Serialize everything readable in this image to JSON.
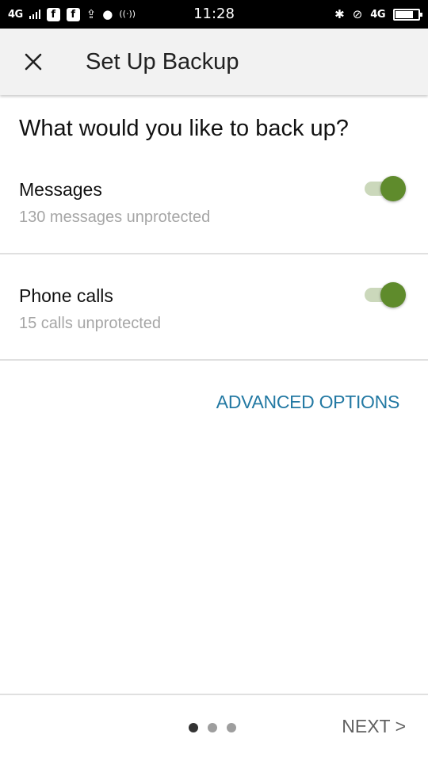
{
  "status_bar": {
    "network": "4G",
    "network_right": "4G",
    "time": "11:28",
    "icons": [
      "signal-icon",
      "facebook-icon",
      "facebook-icon",
      "upload-icon",
      "chat-icon",
      "hotspot-icon",
      "bluetooth-icon",
      "mute-icon",
      "battery-icon"
    ],
    "fb_glyph": "f",
    "upload_glyph": "⇪",
    "chat_glyph": "●",
    "hotspot_glyph": "((·))",
    "bluetooth_glyph": "✱",
    "mute_glyph": "⊘"
  },
  "app_bar": {
    "title": "Set Up Backup",
    "close_icon": "close-icon"
  },
  "content": {
    "question": "What would you like to back up?",
    "options": [
      {
        "label": "Messages",
        "subtitle": "130 messages unprotected",
        "enabled": true
      },
      {
        "label": "Phone calls",
        "subtitle": "15 calls unprotected",
        "enabled": true
      }
    ],
    "advanced_label": "ADVANCED OPTIONS"
  },
  "footer": {
    "page_index": 1,
    "page_count": 3,
    "next_label": "NEXT >"
  },
  "colors": {
    "accent": "#2379a3",
    "toggle_on": "#5f8b2c",
    "toggle_track": "#cbd8bb",
    "app_bar_bg": "#f2f2f2"
  }
}
